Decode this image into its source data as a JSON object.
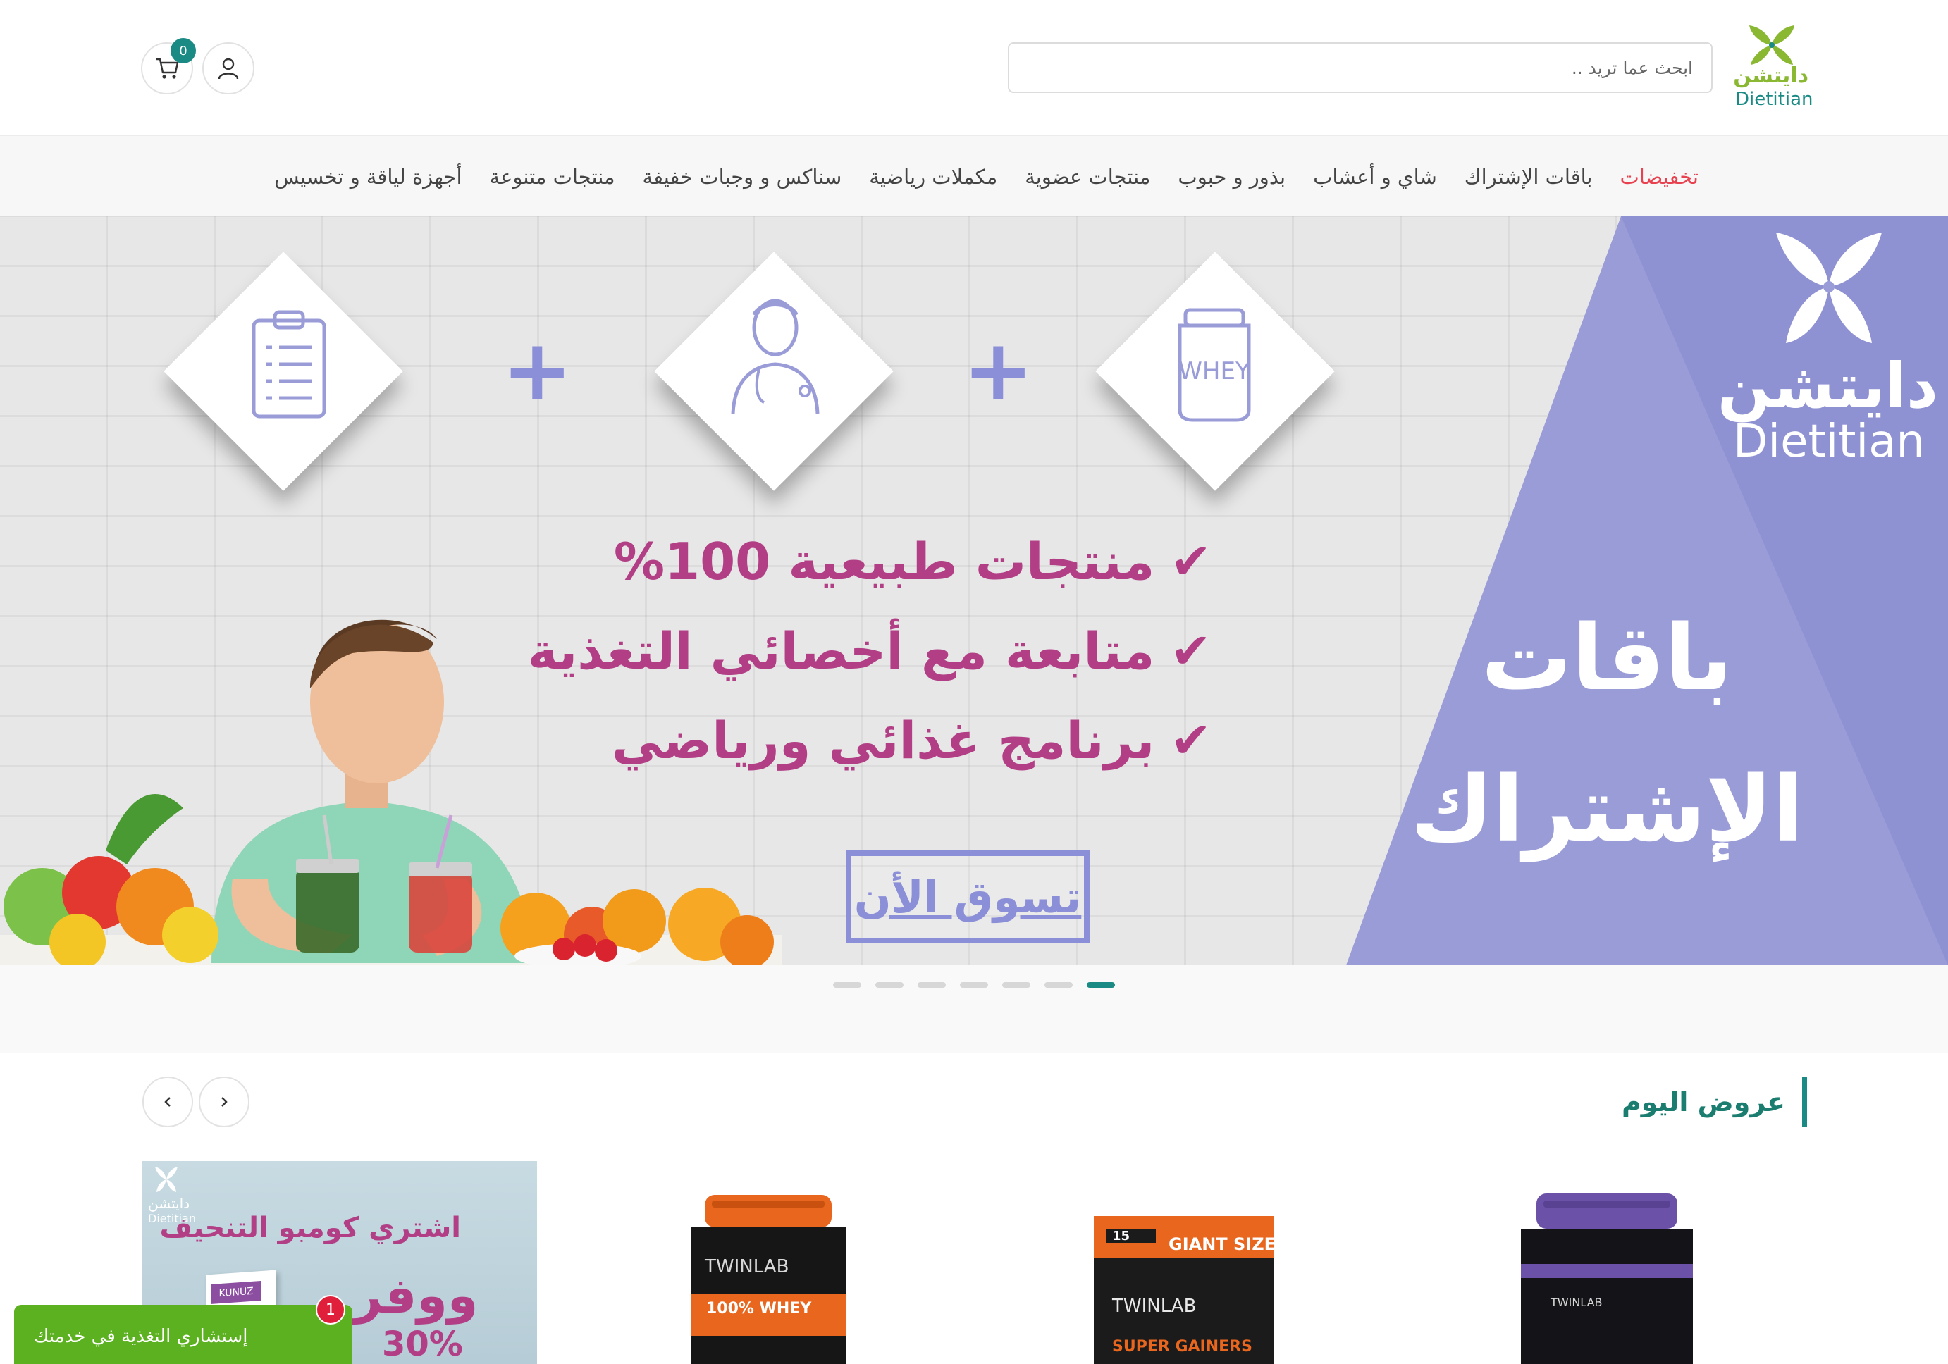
{
  "brand": {
    "name_ar": "دايتشن",
    "name_en": "Dietitian",
    "accent_green": "#8ab833",
    "accent_teal": "#1a8a84"
  },
  "header": {
    "search_placeholder": "ابحث عما تريد ..",
    "cart_count": "0",
    "user_icon": "user-icon",
    "cart_icon": "cart-icon"
  },
  "nav": {
    "items": [
      "تخفيضات",
      "باقات الإشتراك",
      "شاي و أعشاب",
      "بذور و حبوب",
      "منتجات عضوية",
      "مكملات رياضية",
      "سناكس و وجبات خفيفة",
      "منتجات متنوعة",
      "أجهزة لياقة و تخسيس"
    ],
    "sale_color": "#e8414f"
  },
  "hero": {
    "brand_ar": "دايتشن",
    "brand_en": "Dietitian",
    "title_line1": "باقات",
    "title_line2": "الإشتراك",
    "features": [
      "منتجات طبيعية 100%",
      "متابعة مع أخصائي التغذية",
      "برنامج غذائي ورياضي"
    ],
    "whey_label": "WHEY",
    "cta": "تسوق الأن",
    "triangle_color": "#9a9cd8",
    "feature_color": "#b23f86",
    "slide_count": 7,
    "active_slide": 7
  },
  "deals": {
    "title": "عروض اليوم",
    "prev_icon": "chevron-left-icon",
    "next_icon": "chevron-right-icon",
    "promo": {
      "brand_ar": "دايتشن",
      "brand_en": "Dietitian",
      "title": "اشتري كومبو التنحيف",
      "save": "ووفر",
      "percent": "30%",
      "box_label": "KUNUZ"
    },
    "products": [
      {
        "brand": "TWINLAB",
        "label": "100% WHEY"
      },
      {
        "brand": "TWINLAB",
        "label": "SUPER GAINERS",
        "badge": "GIANT SIZE!",
        "badge_num": "15"
      },
      {
        "brand": "TWINLAB",
        "label": ""
      }
    ]
  },
  "chat": {
    "label": "إستشاري التغذية في خدمتك",
    "badge": "1"
  }
}
